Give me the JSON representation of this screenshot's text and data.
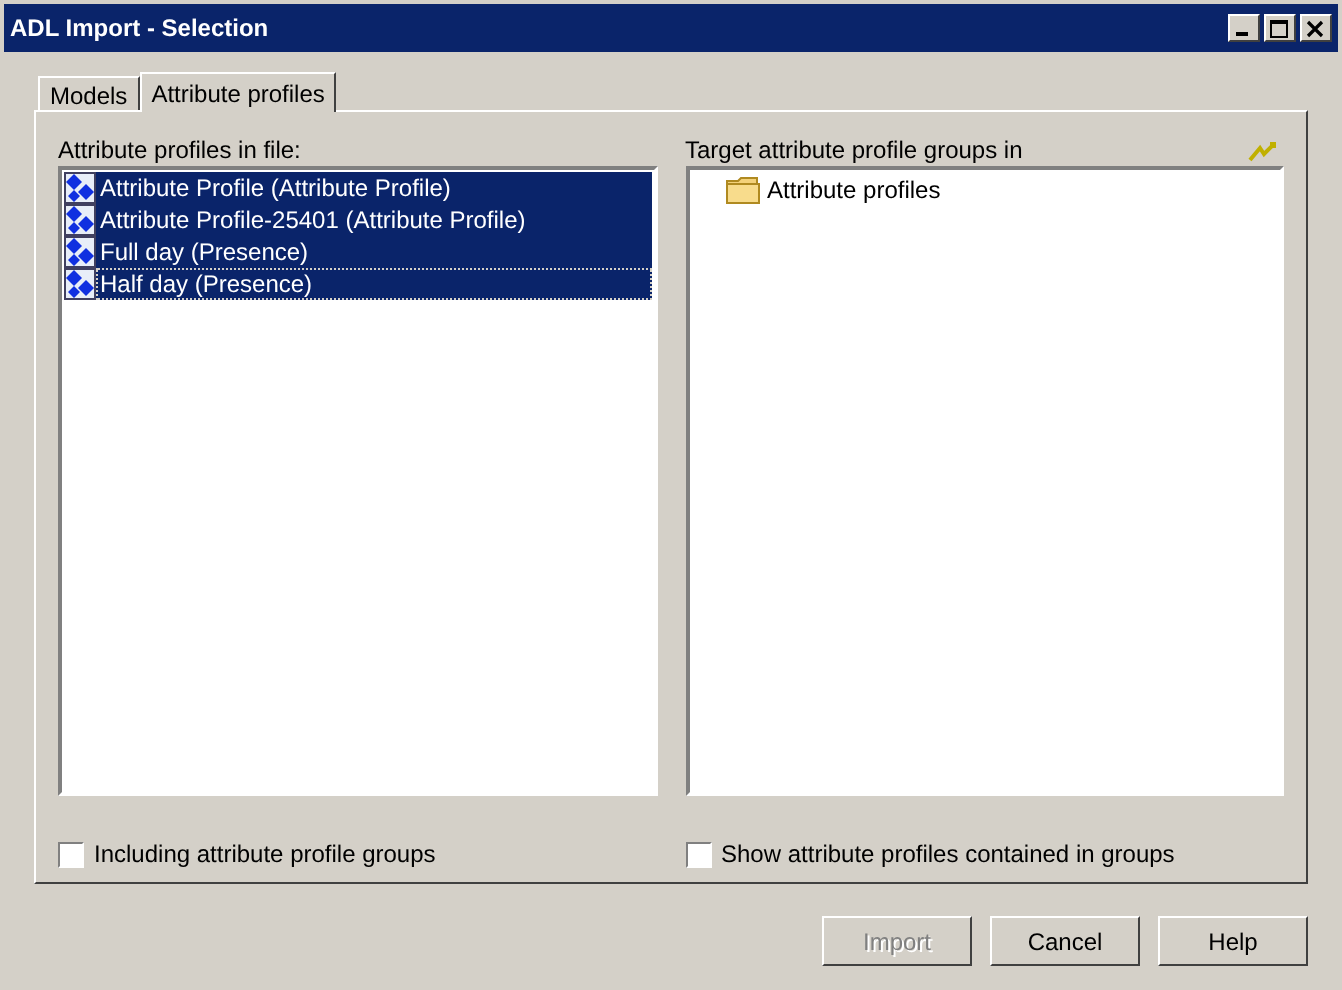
{
  "window": {
    "title": "ADL Import - Selection"
  },
  "tabs": [
    {
      "label": "Models",
      "selected": false
    },
    {
      "label": "Attribute profiles",
      "selected": true
    }
  ],
  "left_list": {
    "label": "Attribute profiles in file:",
    "items": [
      {
        "label": "Attribute Profile (Attribute Profile)",
        "selected": true,
        "focused": false
      },
      {
        "label": "Attribute Profile-25401 (Attribute Profile)",
        "selected": true,
        "focused": false
      },
      {
        "label": "Full day (Presence)",
        "selected": true,
        "focused": false
      },
      {
        "label": "Half day (Presence)",
        "selected": true,
        "focused": true
      }
    ]
  },
  "right_tree": {
    "label": "Target attribute profile groups in",
    "items": [
      {
        "label": "Attribute profiles",
        "selected": false
      }
    ]
  },
  "checkboxes": [
    {
      "label": "Including attribute profile groups",
      "checked": false
    },
    {
      "label": "Show attribute profiles contained in groups",
      "checked": false
    }
  ],
  "buttons": [
    {
      "label": "Import",
      "disabled": true
    },
    {
      "label": "Cancel",
      "disabled": false
    },
    {
      "label": "Help",
      "disabled": false
    }
  ]
}
